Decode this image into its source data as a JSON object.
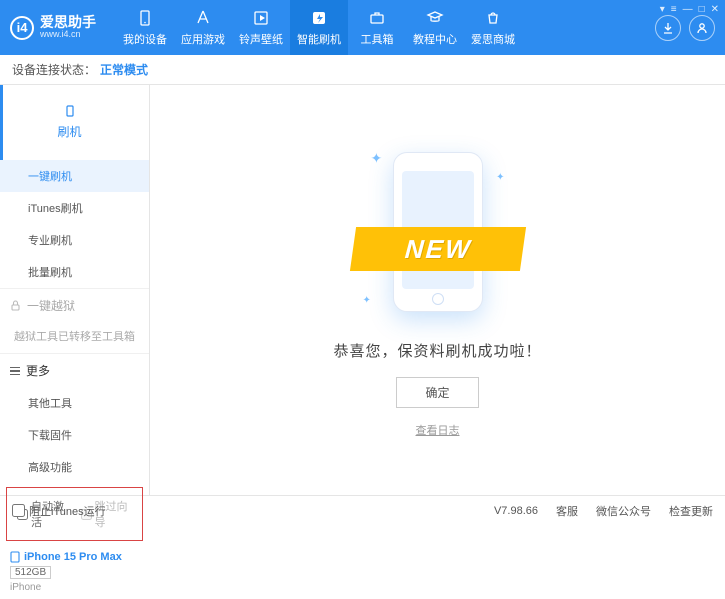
{
  "header": {
    "logo_text": "爱思助手",
    "logo_url": "www.i4.cn",
    "nav": [
      {
        "label": "我的设备"
      },
      {
        "label": "应用游戏"
      },
      {
        "label": "铃声壁纸"
      },
      {
        "label": "智能刷机"
      },
      {
        "label": "工具箱"
      },
      {
        "label": "教程中心"
      },
      {
        "label": "爱思商城"
      }
    ]
  },
  "status": {
    "label": "设备连接状态：",
    "mode": "正常模式"
  },
  "sidebar": {
    "flash": {
      "title": "刷机",
      "items": [
        "一键刷机",
        "iTunes刷机",
        "专业刷机",
        "批量刷机"
      ]
    },
    "jailbreak": {
      "title": "一键越狱",
      "note": "越狱工具已转移至工具箱"
    },
    "more": {
      "title": "更多",
      "items": [
        "其他工具",
        "下载固件",
        "高级功能"
      ]
    },
    "checks": {
      "auto_activate": "自动激活",
      "skip_guide": "跳过向导"
    },
    "device": {
      "name": "iPhone 15 Pro Max",
      "storage": "512GB",
      "type": "iPhone"
    }
  },
  "main": {
    "new_badge": "NEW",
    "success": "恭喜您，保资料刷机成功啦！",
    "ok": "确定",
    "log": "查看日志"
  },
  "footer": {
    "block_itunes": "阻止iTunes运行",
    "version": "V7.98.66",
    "links": [
      "客服",
      "微信公众号",
      "检查更新"
    ]
  }
}
